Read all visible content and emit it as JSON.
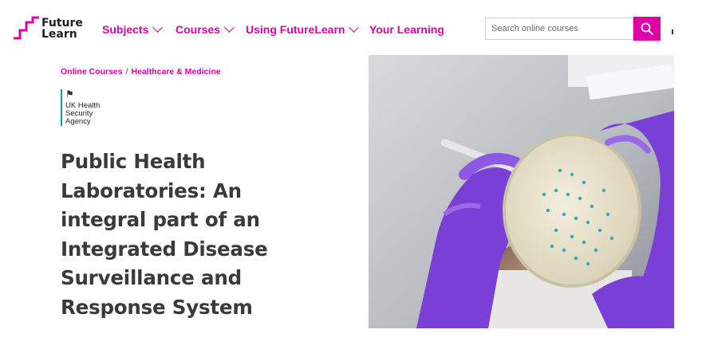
{
  "brand": {
    "logo_line1": "Future",
    "logo_line2": "Learn"
  },
  "nav": {
    "items": [
      {
        "label": "Subjects",
        "dropdown": true
      },
      {
        "label": "Courses",
        "dropdown": true
      },
      {
        "label": "Using FutureLearn",
        "dropdown": true
      },
      {
        "label": "Your Learning",
        "dropdown": false
      }
    ]
  },
  "search": {
    "placeholder": "Search online courses",
    "icon": "search-icon"
  },
  "breadcrumb": {
    "items": [
      "Online Courses",
      "Healthcare & Medicine"
    ],
    "separator": "/"
  },
  "organisation": {
    "name_lines": [
      "UK Health",
      "Security",
      "Agency"
    ],
    "icon": "royal-crest-icon"
  },
  "course": {
    "title": "Public Health Laboratories: An integral part of an Integrated Disease Surveillance and Response System"
  },
  "hero": {
    "description": "gloved hands holding a petri dish with bacterial colonies"
  },
  "colors": {
    "accent": "#de00a5",
    "text": "#3a3a3a",
    "org_rule": "#00a499",
    "glove": "#7a3fd6"
  }
}
